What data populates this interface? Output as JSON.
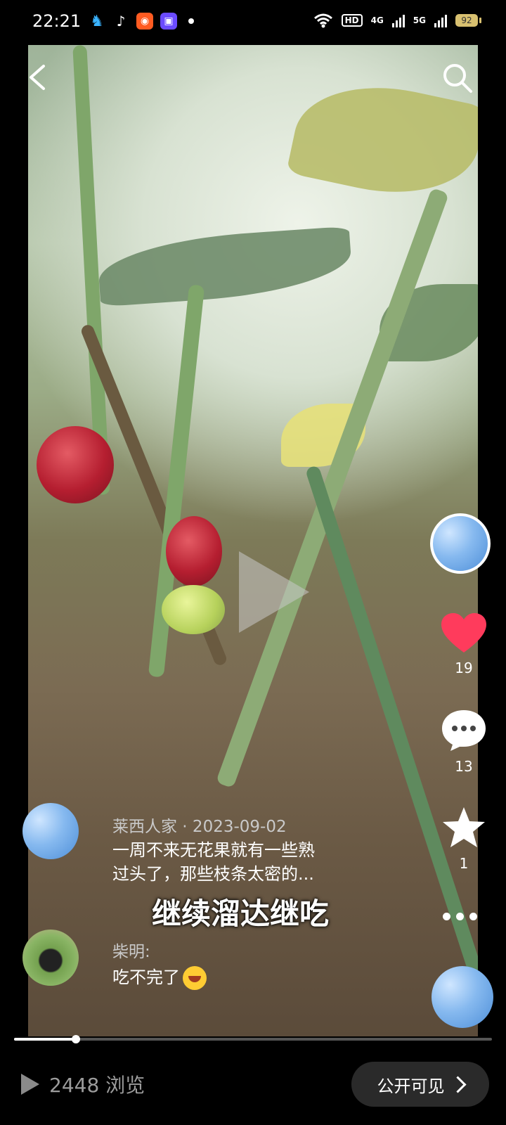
{
  "status_bar": {
    "time": "22:21",
    "hd_label": "HD",
    "net1": "4G",
    "net2": "5G",
    "battery": "92"
  },
  "video": {
    "overlay_subtitle": "继续溜达继吃",
    "progress_fraction": 0.13
  },
  "actions": {
    "like_count": "19",
    "comment_count": "13",
    "favorite_count": "1"
  },
  "caption": {
    "author_date": "莱西人家 · 2023-09-02",
    "text_line1": "一周不来无花果就有一些熟",
    "text_line2": "过头了，那些枝条太密的..."
  },
  "comment": {
    "name": "柴明:",
    "text": "吃不完了"
  },
  "bottom_bar": {
    "views": "2448 浏览",
    "visibility_button": "公开可见"
  },
  "colors": {
    "like_red": "#ff3b5c",
    "pill_bg": "#2a2a2a"
  },
  "icons": [
    "back-arrow-icon",
    "search-icon",
    "heart-icon",
    "comment-icon",
    "star-icon",
    "more-icon",
    "play-icon",
    "chevron-right-icon"
  ]
}
